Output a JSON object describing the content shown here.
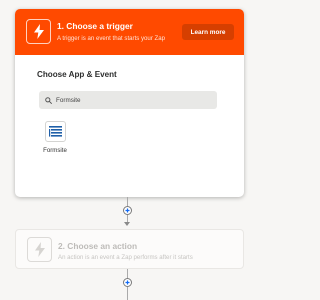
{
  "trigger": {
    "title": "1. Choose a trigger",
    "subtitle": "A trigger is an event that starts your Zap",
    "learn_more": "Learn more",
    "icon": "bolt-icon",
    "header_color": "#ff4a00"
  },
  "choose_app": {
    "title": "Choose App & Event",
    "search": {
      "placeholder": "Formsite",
      "value": "Formsite"
    },
    "apps": [
      {
        "label": "Formsite",
        "icon": "formsite-logo-icon"
      }
    ]
  },
  "action": {
    "title": "2. Choose an action",
    "subtitle": "An action is an event a Zap performs after it starts",
    "icon": "bolt-icon",
    "state": "disabled"
  },
  "accent_color": "#136bf5"
}
